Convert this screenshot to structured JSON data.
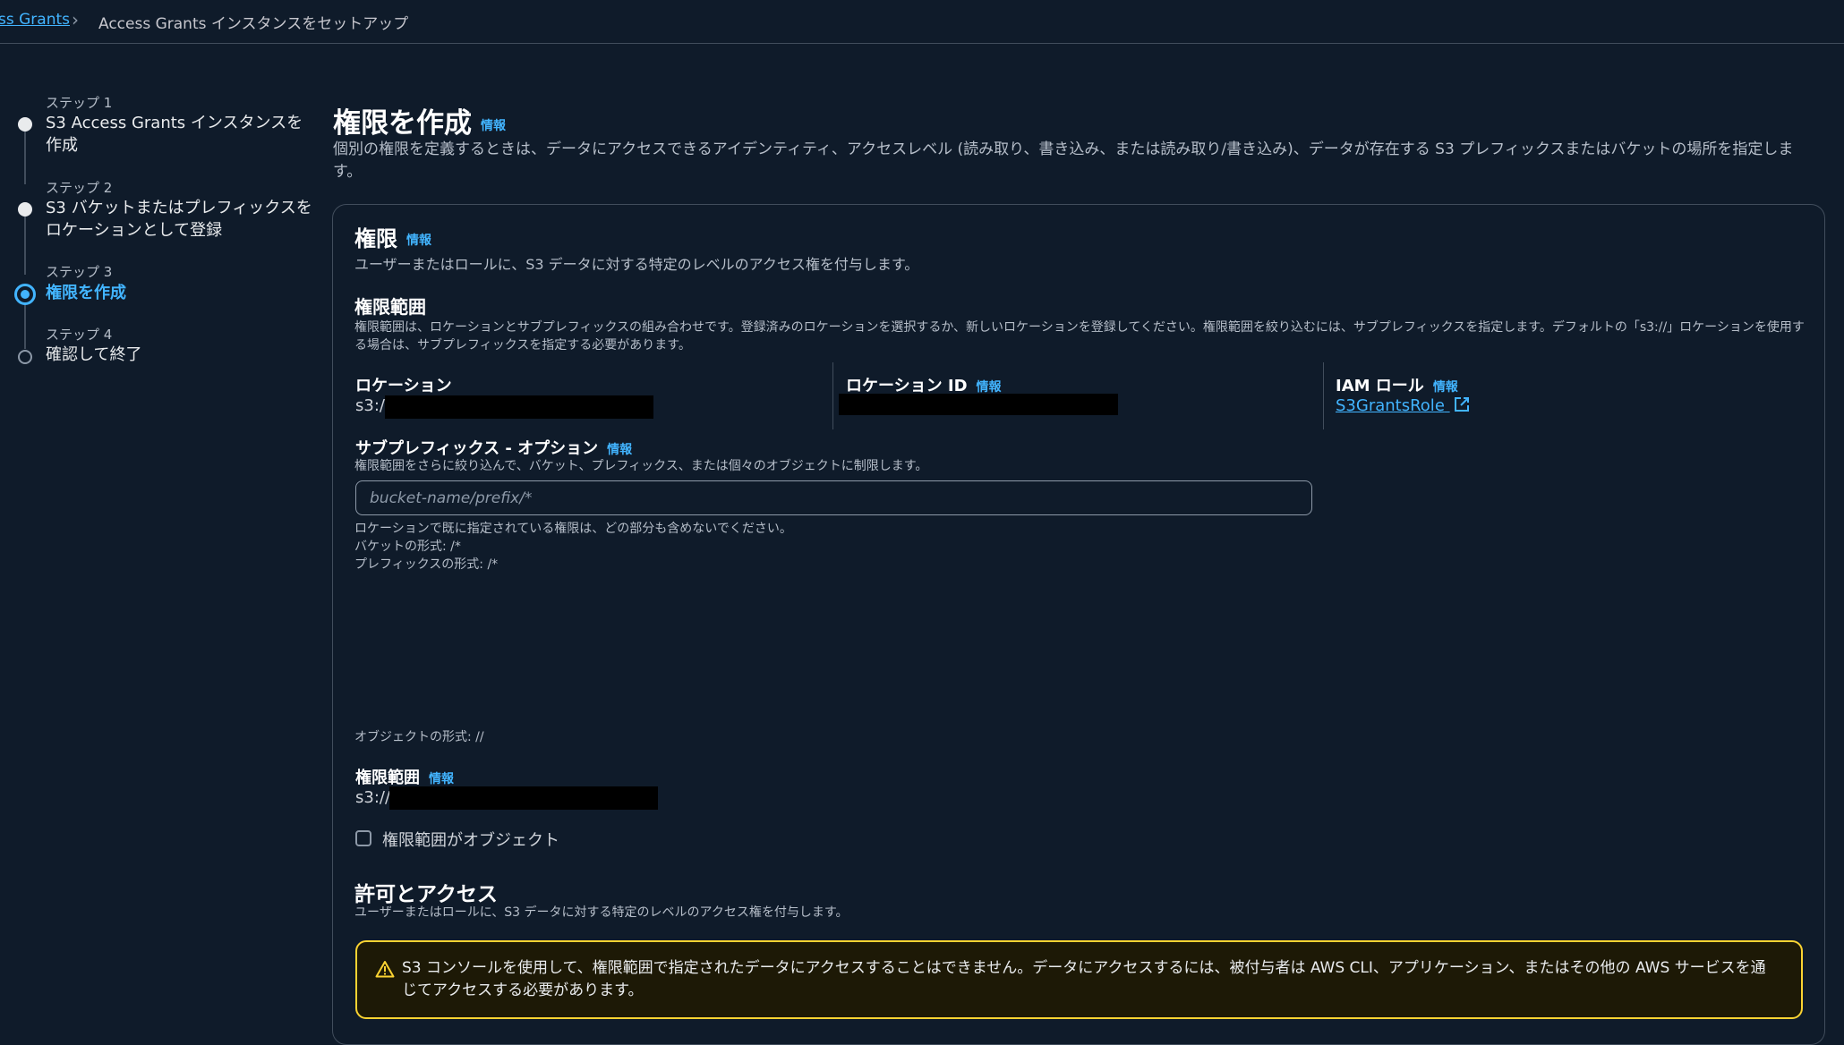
{
  "breadcrumb": {
    "parent": "ss Grants",
    "current": "Access Grants インスタンスをセットアップ"
  },
  "steps": [
    {
      "label": "ステップ 1",
      "title": "S3 Access Grants インスタンスを作成",
      "state": "done"
    },
    {
      "label": "ステップ 2",
      "title": "S3 バケットまたはプレフィックスをロケーションとして登録",
      "state": "done"
    },
    {
      "label": "ステップ 3",
      "title": "権限を作成",
      "state": "current"
    },
    {
      "label": "ステップ 4",
      "title": "確認して終了",
      "state": "todo"
    }
  ],
  "page": {
    "title": "権限を作成",
    "info": "情報",
    "description": "個別の権限を定義するときは、データにアクセスできるアイデンティティ、アクセスレベル (読み取り、書き込み、または読み取り/書き込み)、データが存在する S3 プレフィックスまたはバケットの場所を指定します。"
  },
  "grant": {
    "title": "権限",
    "info": "情報",
    "description": "ユーザーまたはロールに、S3 データに対する特定のレベルのアクセス権を付与します。"
  },
  "scope": {
    "title": "権限範囲",
    "description": "権限範囲は、ロケーションとサブプレフィックスの組み合わせです。登録済みのロケーションを選択するか、新しいロケーションを登録してください。権限範囲を絞り込むには、サブプレフィックスを指定します。デフォルトの「s3://」ロケーションを使用する場合は、サブプレフィックスを指定する必要があります。",
    "location_label": "ロケーション",
    "location_value": "s3:/",
    "location_id_label": "ロケーション ID",
    "info": "情報",
    "iam_label": "IAM ロール",
    "iam_value": "S3GrantsRole"
  },
  "subprefix": {
    "label": "サブプレフィックス - オプション",
    "info": "情報",
    "description": "権限範囲をさらに絞り込んで、バケット、プレフィックス、または個々のオブジェクトに制限します。",
    "placeholder": "bucket-name/prefix/*",
    "hint1": "ロケーションで既に指定されている権限は、どの部分も含めないでください。",
    "hint2": "バケットの形式: /*",
    "hint3": "プレフィックスの形式: /*",
    "hint4": "オブジェクトの形式: //"
  },
  "scope_result": {
    "label": "権限範囲",
    "info": "情報",
    "value": "s3://"
  },
  "checkbox": {
    "label": "権限範囲がオブジェクト",
    "checked": false
  },
  "permissions": {
    "title": "許可とアクセス",
    "description": "ユーザーまたはロールに、S3 データに対する特定のレベルのアクセス権を付与します。"
  },
  "alert": {
    "text": "S3 コンソールを使用して、権限範囲で指定されたデータにアクセスすることはできません。データにアクセスするには、被付与者は AWS CLI、アプリケーション、またはその他の AWS サービスを通じてアクセスする必要があります。",
    "icon": "warning-icon"
  },
  "colors": {
    "background": "#0f1b2a",
    "accent": "#42b4ff",
    "warning": "#fbd332"
  }
}
